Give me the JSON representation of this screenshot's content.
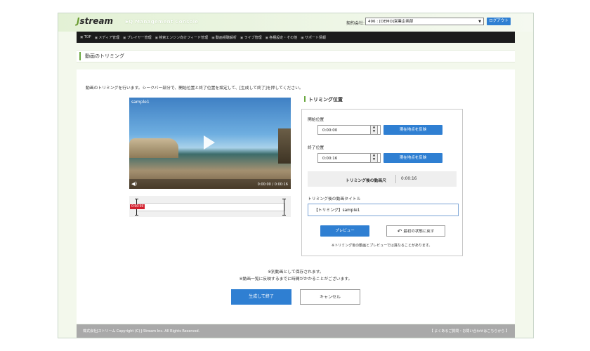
{
  "header": {
    "logo_mark": "J",
    "logo_text": "stream",
    "app_title": "EQ Management Console",
    "account_label": "契約会社:",
    "account_value": "496 : [DEMO]営業企画部",
    "logout_label": "ログアウト"
  },
  "nav": {
    "items": [
      "TOP",
      "メディア管理",
      "プレイヤー管理",
      "検索エンジン向けフィード管理",
      "動画視聴解析",
      "ライブ管理",
      "各種設定・その他",
      "サポート情報"
    ]
  },
  "page": {
    "title": "動画のトリミング",
    "intro": "動画のトリミングを行います。シークバー部分で、開始位置と終了位置を設定して、[生成して終了]を押してください。"
  },
  "video": {
    "title": "sample1",
    "time": "0:00:00 / 0:00:16",
    "trim_tag": "0:00:00"
  },
  "trim": {
    "heading": "トリミング位置",
    "start_label": "開始位置",
    "start_value": "0:00:00",
    "end_label": "終了位置",
    "end_value": "0:00:16",
    "apply_current_label": "現在地点を反映",
    "duration_label": "トリミング後の動画尺",
    "duration_value": "0:00:16",
    "title_label": "トリミング後の動画タイトル",
    "title_value": "【トリミング】sample1",
    "preview_label": "プレビュー",
    "reset_label": "最初の状態に戻す",
    "note": "※トリミング後の動画とプレビューでは異なることがあります。"
  },
  "footer_notes": {
    "line1": "※別動画として保存されます。",
    "line2": "※動画一覧に反映するまでに時間がかかることがございます。"
  },
  "actions": {
    "finish_label": "生成して終了",
    "cancel_label": "キャンセル"
  },
  "footer": {
    "copyright": "株式会社Jストリーム Copyright (C) J-Stream Inc. All Rights Reserved.",
    "inquiry": "【 よくあるご質問・お問い合わせはこちらから 】"
  }
}
